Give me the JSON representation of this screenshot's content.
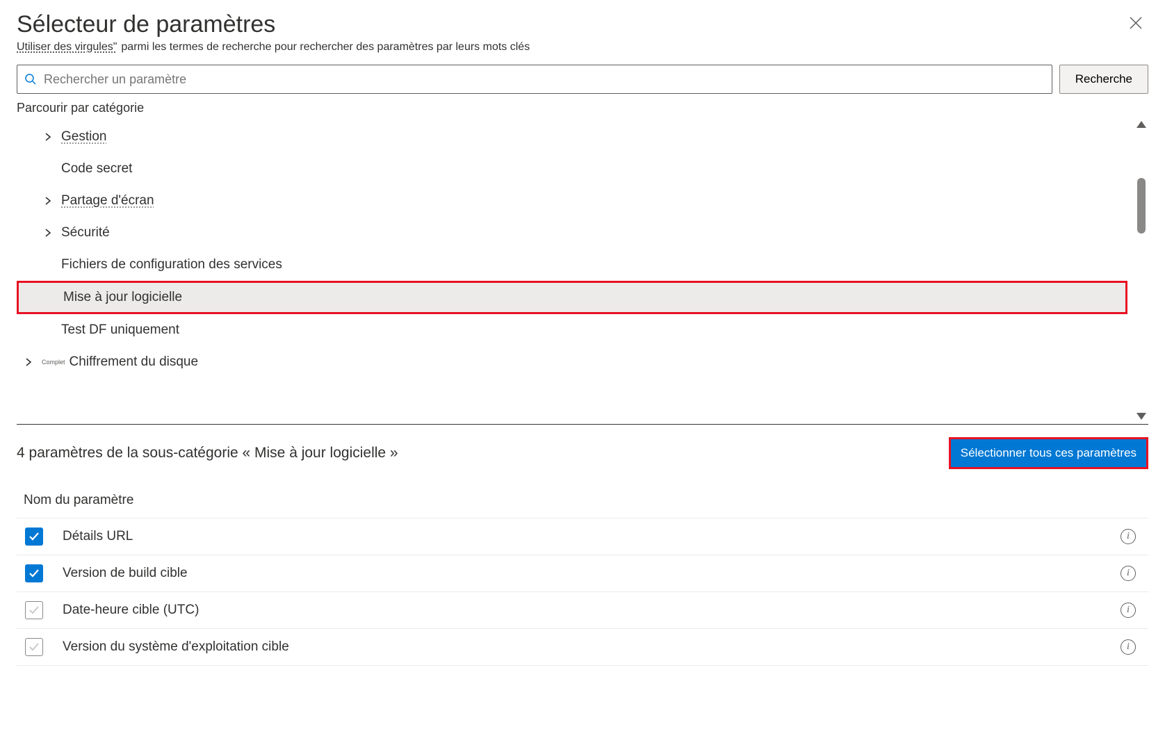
{
  "header": {
    "title": "Sélecteur de paramètres",
    "subtitle_part1": "Utiliser des virgules\"",
    "subtitle_part2": "parmi les termes de recherche pour rechercher des paramètres par leurs mots clés"
  },
  "search": {
    "placeholder": "Rechercher un paramètre",
    "button_label": "Recherche"
  },
  "browse": {
    "label": "Parcourir par catégorie"
  },
  "categories": [
    {
      "label": "Gestion",
      "expandable": true,
      "indent": 1,
      "underline": true
    },
    {
      "label": "Code secret",
      "expandable": false,
      "indent": 1,
      "underline": false
    },
    {
      "label": "Partage d'écran",
      "expandable": true,
      "indent": 1,
      "underline": true
    },
    {
      "label": "Sécurité",
      "expandable": true,
      "indent": 1,
      "underline": false
    },
    {
      "label": "Fichiers de configuration des services",
      "expandable": false,
      "indent": 1,
      "underline": false
    },
    {
      "label": "Mise à jour logicielle",
      "expandable": false,
      "indent": 1,
      "underline": false,
      "selected": true
    },
    {
      "label": "Test DF uniquement",
      "expandable": false,
      "indent": 1,
      "underline": false
    },
    {
      "label": "Chiffrement du disque",
      "expandable": true,
      "indent": 0,
      "underline": false,
      "badge": "Complet"
    }
  ],
  "subcategory": {
    "count_text": "4 paramètres de la sous-catégorie « Mise à jour logicielle »",
    "select_all": "Sélectionner tous ces paramètres",
    "column_header": "Nom du paramètre"
  },
  "settings": [
    {
      "name": "Détails   URL",
      "checked": true
    },
    {
      "name": "Version de build cible",
      "checked": true
    },
    {
      "name": "Date-heure cible (UTC)",
      "checked": false
    },
    {
      "name": "Version du système d'exploitation cible",
      "checked": false
    }
  ]
}
